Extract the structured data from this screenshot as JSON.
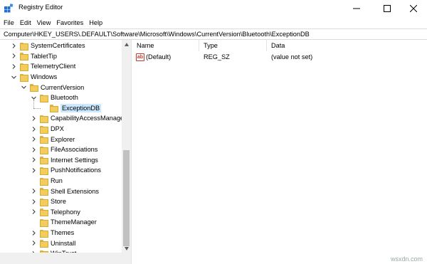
{
  "window": {
    "title": "Registry Editor",
    "controls": {
      "minimize": "minimize-icon",
      "maximize": "maximize-icon",
      "close": "close-icon"
    }
  },
  "menu": [
    "File",
    "Edit",
    "View",
    "Favorites",
    "Help"
  ],
  "address": "Computer\\HKEY_USERS\\.DEFAULT\\Software\\Microsoft\\Windows\\CurrentVersion\\Bluetooth\\ExceptionDB",
  "tree": [
    {
      "label": "SystemCertificates",
      "level": 0,
      "state": "collapsed"
    },
    {
      "label": "TabletTip",
      "level": 0,
      "state": "collapsed"
    },
    {
      "label": "TelemetryClient",
      "level": 0,
      "state": "collapsed"
    },
    {
      "label": "Windows",
      "level": 0,
      "state": "expanded"
    },
    {
      "label": "CurrentVersion",
      "level": 1,
      "state": "expanded"
    },
    {
      "label": "Bluetooth",
      "level": 2,
      "state": "expanded"
    },
    {
      "label": "ExceptionDB",
      "level": 3,
      "state": "leaf",
      "selected": true
    },
    {
      "label": "CapabilityAccessManager",
      "level": 2,
      "state": "collapsed"
    },
    {
      "label": "DPX",
      "level": 2,
      "state": "collapsed"
    },
    {
      "label": "Explorer",
      "level": 2,
      "state": "collapsed"
    },
    {
      "label": "FileAssociations",
      "level": 2,
      "state": "collapsed"
    },
    {
      "label": "Internet Settings",
      "level": 2,
      "state": "collapsed"
    },
    {
      "label": "PushNotifications",
      "level": 2,
      "state": "collapsed"
    },
    {
      "label": "Run",
      "level": 2,
      "state": "leaf"
    },
    {
      "label": "Shell Extensions",
      "level": 2,
      "state": "collapsed"
    },
    {
      "label": "Store",
      "level": 2,
      "state": "collapsed"
    },
    {
      "label": "Telephony",
      "level": 2,
      "state": "collapsed"
    },
    {
      "label": "ThemeManager",
      "level": 2,
      "state": "leaf"
    },
    {
      "label": "Themes",
      "level": 2,
      "state": "collapsed"
    },
    {
      "label": "Uninstall",
      "level": 2,
      "state": "collapsed"
    },
    {
      "label": "WinTrust",
      "level": 2,
      "state": "collapsed"
    }
  ],
  "columns": {
    "name": "Name",
    "type": "Type",
    "data": "Data"
  },
  "values": [
    {
      "icon": "ab",
      "name": "(Default)",
      "type": "REG_SZ",
      "data": "(value not set)"
    }
  ],
  "watermark": "wsxdn.com"
}
